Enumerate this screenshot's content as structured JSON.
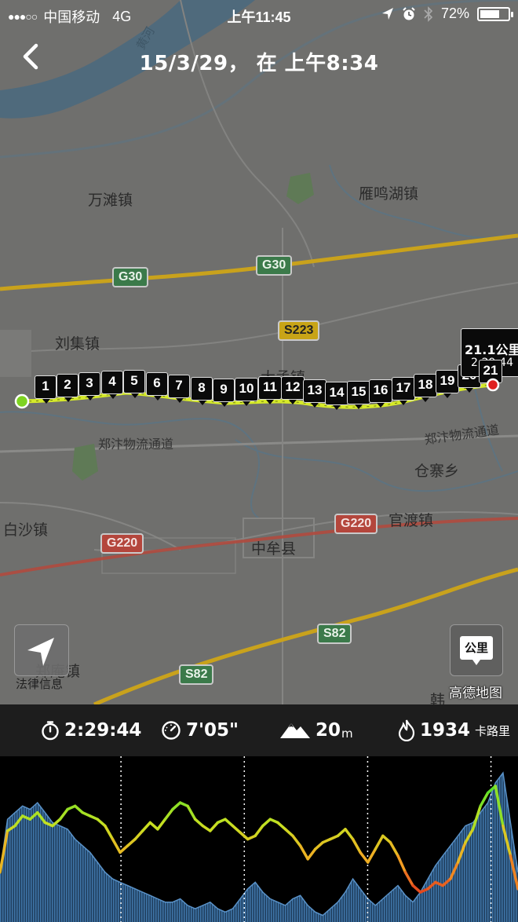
{
  "status_bar": {
    "carrier": "中国移动",
    "network": "4G",
    "time": "上午11:45",
    "battery_percent": "72%",
    "battery_level": 0.72
  },
  "nav": {
    "title": "15/3/29， 在 上午8:34"
  },
  "map": {
    "places": {
      "river": "黄河",
      "wantan": "万滩镇",
      "yanminghu": "雁鸣湖镇",
      "liuji": "刘集镇",
      "dameng": "大孟镇",
      "logistics1": "郑汴物流通道",
      "logistics2": "郑汴物流通道",
      "cangzhai": "仓寨乡",
      "baisha": "白沙镇",
      "guandu": "官渡镇",
      "zhongmu": "中牟县",
      "zhengan": "郑庵镇",
      "hanzhuang": "韩"
    },
    "shields": {
      "g30_a": "G30",
      "g30_b": "G30",
      "s223": "S223",
      "g220_a": "G220",
      "g220_b": "G220",
      "s82_a": "S82",
      "s82_b": "S82"
    },
    "km_markers": [
      "1",
      "2",
      "3",
      "4",
      "5",
      "6",
      "7",
      "8",
      "9",
      "10",
      "11",
      "12",
      "13",
      "14",
      "15",
      "16",
      "17",
      "18",
      "19",
      "20",
      "21"
    ],
    "distance_label": "21.1公里",
    "time_label": "2:29:44",
    "unit_button_label": "公里",
    "legal_link": "法律信息",
    "brand": "高德地图",
    "route_color": "#d6ea2a",
    "start_color": "#7ed321",
    "end_color": "#e02020"
  },
  "stats": {
    "duration": "2:29:44",
    "pace": "7'05\"",
    "elevation_value": "20",
    "elevation_unit": "m",
    "calories_value": "1934",
    "calories_unit": "卡路里"
  },
  "chart_data": {
    "type": "line",
    "series": [
      {
        "values": [
          30,
          55,
          58,
          64,
          62,
          66,
          60,
          58,
          62,
          68,
          70,
          66,
          64,
          62,
          58,
          50,
          42,
          46,
          50,
          55,
          60,
          56,
          62,
          68,
          72,
          70,
          62,
          58,
          55,
          60,
          62,
          58,
          54,
          50,
          52,
          58,
          62,
          60,
          56,
          52,
          46,
          38,
          44,
          48,
          50,
          52,
          56,
          50,
          42,
          36,
          44,
          52,
          48,
          40,
          30,
          22,
          18,
          20,
          24,
          22,
          26,
          36,
          48,
          56,
          70,
          78,
          82,
          58,
          40,
          20
        ],
        "color_range": [
          "#e0341c",
          "#f5a623",
          "#c8e021",
          "#5ee02a"
        ]
      },
      {
        "values": [
          30,
          62,
          66,
          70,
          68,
          72,
          66,
          60,
          58,
          56,
          50,
          46,
          42,
          36,
          30,
          26,
          24,
          22,
          20,
          18,
          16,
          14,
          12,
          12,
          14,
          10,
          8,
          10,
          12,
          8,
          6,
          8,
          14,
          20,
          24,
          18,
          14,
          12,
          10,
          14,
          16,
          10,
          6,
          4,
          8,
          12,
          18,
          26,
          20,
          14,
          10,
          14,
          18,
          22,
          16,
          12,
          18,
          26,
          34,
          40,
          46,
          52,
          58,
          60,
          66,
          72,
          84,
          90,
          60,
          30
        ],
        "color": "#3a6c9c"
      }
    ],
    "split_markers": 5
  }
}
